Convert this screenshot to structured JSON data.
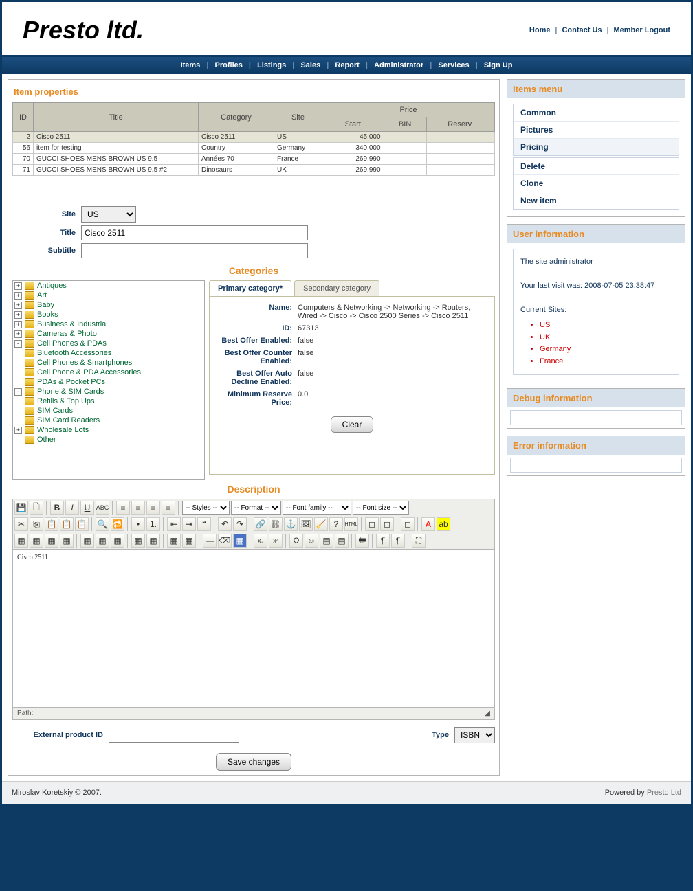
{
  "brand": "Presto ltd.",
  "toplinks": {
    "home": "Home",
    "contact": "Contact Us",
    "logout": "Member Logout"
  },
  "nav": [
    "Items",
    "Profiles",
    "Listings",
    "Sales",
    "Report",
    "Administrator",
    "Services",
    "Sign Up"
  ],
  "page_title": "Item properties",
  "grid_headers": {
    "id": "ID",
    "title": "Title",
    "category": "Category",
    "site": "Site",
    "price": "Price",
    "start": "Start",
    "bin": "BIN",
    "reserv": "Reserv."
  },
  "rows": [
    {
      "id": "2",
      "title": "Cisco 2511",
      "category": "Cisco 2511",
      "site": "US",
      "start": "45.000",
      "bin": "",
      "reserv": ""
    },
    {
      "id": "56",
      "title": "item for testing",
      "category": "Country",
      "site": "Germany",
      "start": "340.000",
      "bin": "",
      "reserv": ""
    },
    {
      "id": "70",
      "title": "GUCCI SHOES MENS BROWN US 9.5",
      "category": "Années 70",
      "site": "France",
      "start": "269.990",
      "bin": "",
      "reserv": ""
    },
    {
      "id": "71",
      "title": "GUCCI SHOES MENS BROWN US 9.5 #2",
      "category": "Dinosaurs",
      "site": "UK",
      "start": "269.990",
      "bin": "",
      "reserv": ""
    }
  ],
  "form": {
    "site_label": "Site",
    "site_value": "US",
    "title_label": "Title",
    "title_value": "Cisco 2511",
    "subtitle_label": "Subtitle",
    "subtitle_value": ""
  },
  "cats_hdr": "Categories",
  "tree": [
    {
      "t": "+",
      "l": "Antiques",
      "i": 0
    },
    {
      "t": "+",
      "l": "Art",
      "i": 0
    },
    {
      "t": "+",
      "l": "Baby",
      "i": 0
    },
    {
      "t": "+",
      "l": "Books",
      "i": 0
    },
    {
      "t": "+",
      "l": "Business & Industrial",
      "i": 0
    },
    {
      "t": "+",
      "l": "Cameras & Photo",
      "i": 0
    },
    {
      "t": "-",
      "l": "Cell Phones & PDAs",
      "i": 0
    },
    {
      "t": "",
      "l": "Bluetooth Accessories",
      "i": 1
    },
    {
      "t": "",
      "l": "Cell Phones & Smartphones",
      "i": 1
    },
    {
      "t": "",
      "l": "Cell Phone & PDA Accessories",
      "i": 1
    },
    {
      "t": "",
      "l": "PDAs & Pocket PCs",
      "i": 1
    },
    {
      "t": "-",
      "l": "Phone & SIM Cards",
      "i": 1
    },
    {
      "t": "",
      "l": "Refills & Top Ups",
      "i": 2
    },
    {
      "t": "",
      "l": "SIM Cards",
      "i": 2
    },
    {
      "t": "",
      "l": "SIM Card Readers",
      "i": 2
    },
    {
      "t": "+",
      "l": "Wholesale Lots",
      "i": 1
    },
    {
      "t": "",
      "l": "Other",
      "i": 1
    }
  ],
  "tabs": {
    "primary": "Primary category*",
    "secondary": "Secondary category"
  },
  "detail": {
    "name_l": "Name:",
    "name_v": "Computers & Networking -> Networking -> Routers, Wired -> Cisco -> Cisco 2500 Series -> Cisco 2511",
    "id_l": "ID:",
    "id_v": "67313",
    "bo_l": "Best Offer Enabled:",
    "bo_v": "false",
    "boc_l": "Best Offer Counter Enabled:",
    "boc_v": "false",
    "boad_l": "Best Offer Auto Decline Enabled:",
    "boad_v": "false",
    "mrp_l": "Minimum Reserve Price:",
    "mrp_v": "0.0",
    "clear": "Clear"
  },
  "desc_hdr": "Description",
  "editor": {
    "styles": "-- Styles --",
    "format": "-- Format --",
    "family": "-- Font family --",
    "size": "-- Font size --",
    "content": "Cisco 2511",
    "path": "Path:"
  },
  "bottom": {
    "ext_l": "External product ID",
    "ext_v": "",
    "type_l": "Type",
    "type_v": "ISBN"
  },
  "save": "Save changes",
  "side": {
    "items_menu": "Items menu",
    "menu1": [
      "Common",
      "Pictures",
      "Pricing"
    ],
    "menu2": [
      "Delete",
      "Clone",
      "New item"
    ],
    "user_h": "User information",
    "user_admin": "The site administrator",
    "user_visit": "Your last visit was: 2008-07-05 23:38:47",
    "user_sites_l": "Current Sites:",
    "user_sites": [
      "US",
      "UK",
      "Germany",
      "France"
    ],
    "debug_h": "Debug information",
    "error_h": "Error information"
  },
  "footer": {
    "left": "Miroslav Koretskiy © 2007.",
    "right_l": "Powered by ",
    "right_b": "Presto Ltd"
  }
}
